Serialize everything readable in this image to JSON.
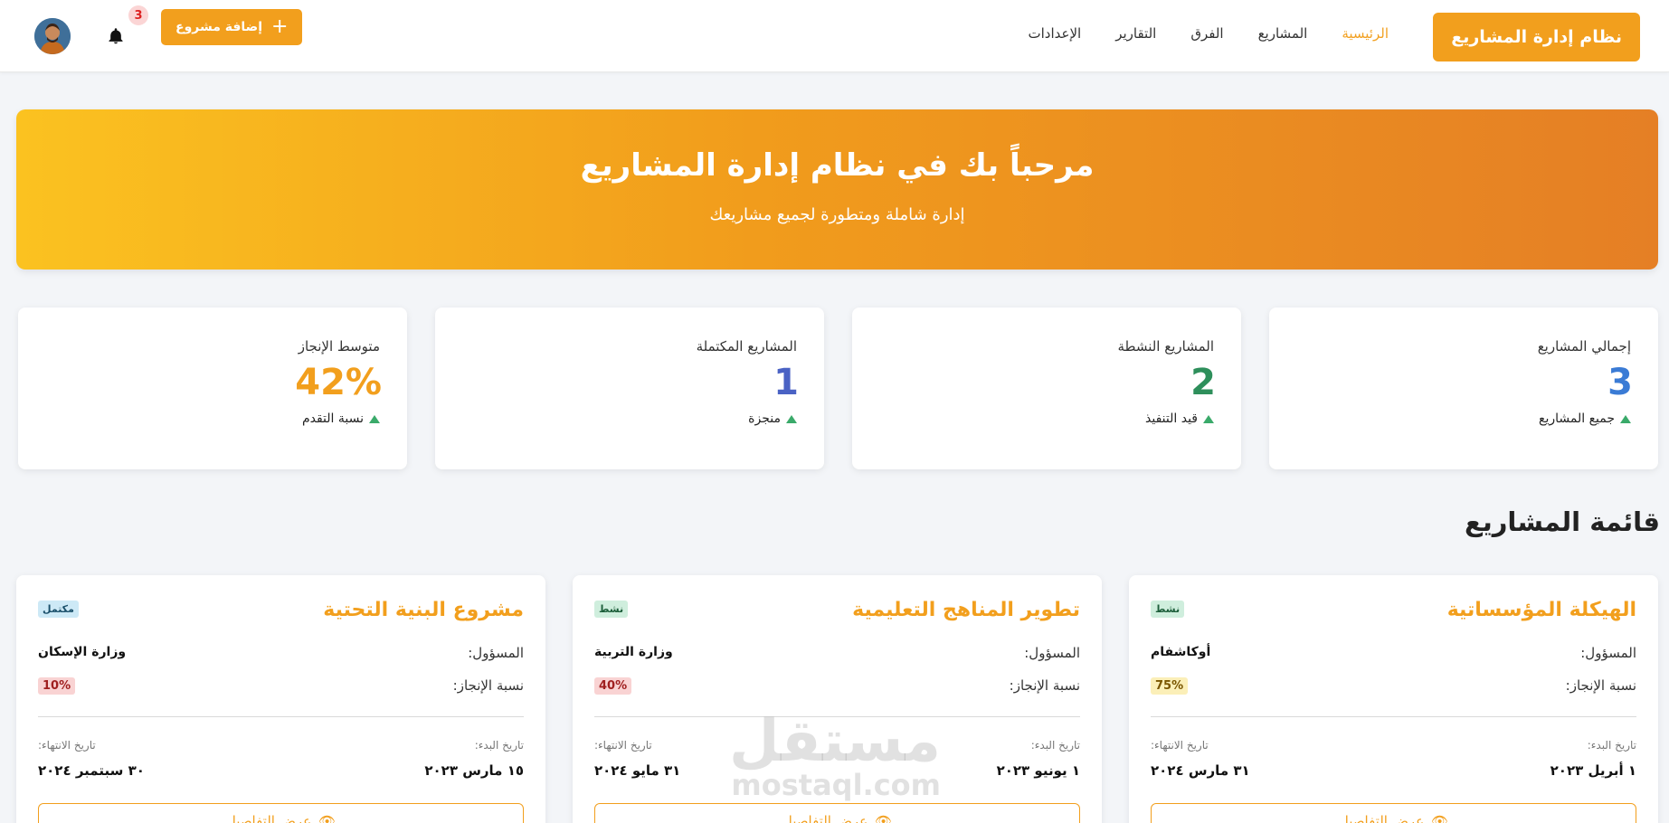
{
  "navbar": {
    "brand": "نظام إدارة المشاريع",
    "links": [
      {
        "label": "الرئيسية",
        "active": true
      },
      {
        "label": "المشاريع",
        "active": false
      },
      {
        "label": "الفرق",
        "active": false
      },
      {
        "label": "التقارير",
        "active": false
      },
      {
        "label": "الإعدادات",
        "active": false
      }
    ],
    "add_project_label": "إضافة مشروع",
    "notifications_count": "3"
  },
  "hero": {
    "title": "مرحباً بك في نظام إدارة المشاريع",
    "subtitle": "إدارة شاملة ومتطورة لجميع مشاريعك"
  },
  "stats": [
    {
      "label": "إجمالي المشاريع",
      "value": "3",
      "foot": "جميع المشاريع",
      "color": "#3a7bd5"
    },
    {
      "label": "المشاريع النشطة",
      "value": "2",
      "foot": "قيد التنفيذ",
      "color": "#2e8f5b"
    },
    {
      "label": "المشاريع المكتملة",
      "value": "1",
      "foot": "منجزة",
      "color": "#4a62c4"
    },
    {
      "label": "متوسط الإنجاز",
      "value": "42%",
      "foot": "نسبة التقدم",
      "color": "#f29f1d"
    }
  ],
  "projects_section_title": "قائمة المشاريع",
  "projects": [
    {
      "title": "الهيكلة المؤسساتية",
      "status": "نشط",
      "owner_label": "المسؤول:",
      "owner": "أوكاشفام",
      "progress_label": "نسبة الإنجاز:",
      "progress": "75%",
      "start_label": "تاريخ البدء:",
      "start": "١ أبريل ٢٠٢٣",
      "end_label": "تاريخ الانتهاء:",
      "end": "٣١ مارس ٢٠٢٤",
      "details_label": "عرض التفاصيل"
    },
    {
      "title": "تطوير المناهج التعليمية",
      "status": "نشط",
      "owner_label": "المسؤول:",
      "owner": "وزارة التربية",
      "progress_label": "نسبة الإنجاز:",
      "progress": "40%",
      "start_label": "تاريخ البدء:",
      "start": "١ يونيو ٢٠٢٣",
      "end_label": "تاريخ الانتهاء:",
      "end": "٣١ مايو ٢٠٢٤",
      "details_label": "عرض التفاصيل"
    },
    {
      "title": "مشروع البنية التحتية",
      "status": "مكتمل",
      "owner_label": "المسؤول:",
      "owner": "وزارة الإسكان",
      "progress_label": "نسبة الإنجاز:",
      "progress": "10%",
      "start_label": "تاريخ البدء:",
      "start": "١٥ مارس ٢٠٢٣",
      "end_label": "تاريخ الانتهاء:",
      "end": "٣٠ سبتمبر ٢٠٢٤",
      "details_label": "عرض التفاصيل"
    }
  ],
  "watermark": {
    "ar": "مستقل",
    "en": "mostaql.com"
  }
}
